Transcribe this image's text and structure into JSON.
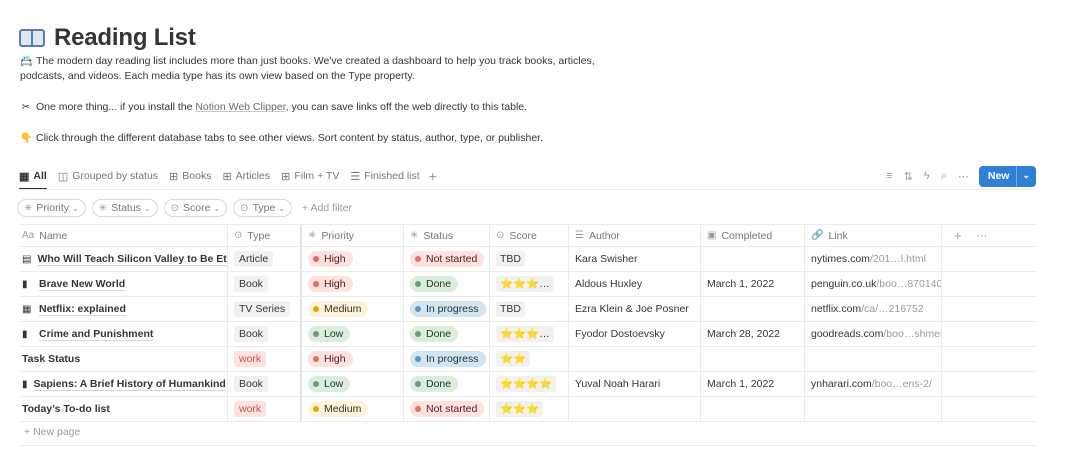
{
  "page": {
    "title": "Reading List",
    "icon": "open-book-icon",
    "desc1_icon": "📇",
    "desc1": "The modern day reading list includes more than just books. We've created a dashboard to help you track books, articles,",
    "desc1b": "podcasts, and videos. Each media type has its own view based on the Type property.",
    "desc2_icon": "✂",
    "desc2_pre": "One more thing... if you install the ",
    "desc2_link": "Notion Web Clipper",
    "desc2_post": ", you can save links off the web directly to this table.",
    "desc3_icon": "👇",
    "desc3": "Click through the different database tabs to see other views. Sort content by status, author, type, or publisher."
  },
  "tabs": [
    {
      "label": "All",
      "icon": "table-icon"
    },
    {
      "label": "Grouped by status",
      "icon": "board-icon"
    },
    {
      "label": "Books",
      "icon": "gallery-icon"
    },
    {
      "label": "Articles",
      "icon": "gallery-icon"
    },
    {
      "label": "Film + TV",
      "icon": "gallery-icon"
    },
    {
      "label": "Finished list",
      "icon": "list-icon"
    }
  ],
  "toolbar": {
    "new_label": "New",
    "accent": "#2f80d3"
  },
  "filters": [
    {
      "label": "Priority"
    },
    {
      "label": "Status"
    },
    {
      "label": "Score"
    },
    {
      "label": "Type"
    }
  ],
  "add_filter_label": "+ Add filter",
  "columns": [
    "Name",
    "Type",
    "Priority",
    "Status",
    "Score",
    "Author",
    "Completed",
    "Link"
  ],
  "rows": [
    {
      "name": "Who Will Teach Silicon Valley to Be Ethi",
      "type": "Article",
      "priority": "High",
      "status": "Not started",
      "score": "TBD",
      "author": "Kara Swisher",
      "completed": "",
      "link_host": "nytimes.com",
      "link_path": "/201…l.html",
      "has_icon": true
    },
    {
      "name": "Brave New World",
      "type": "Book",
      "priority": "High",
      "status": "Done",
      "score": "⭐⭐⭐…",
      "author": "Aldous Huxley",
      "completed": "March 1, 2022",
      "link_host": "penguin.co.uk",
      "link_path": "/boo…870140",
      "has_icon": true
    },
    {
      "name": "Netflix: explained",
      "type": "TV Series",
      "priority": "Medium",
      "status": "In progress",
      "score": "TBD",
      "author": "Ezra Klein & Joe Posner",
      "completed": "",
      "link_host": "netflix.com",
      "link_path": "/ca/…216752",
      "has_icon": true
    },
    {
      "name": "Crime and Punishment",
      "type": "Book",
      "priority": "Low",
      "status": "Done",
      "score": "⭐⭐⭐…",
      "author": "Fyodor Dostoevsky",
      "completed": "March 28, 2022",
      "link_host": "goodreads.com",
      "link_path": "/boo…shment",
      "has_icon": true
    },
    {
      "name": "Task Status",
      "type": "work",
      "priority": "High",
      "status": "In progress",
      "score": "⭐⭐",
      "author": "",
      "completed": "",
      "link_host": "",
      "link_path": "",
      "has_icon": false
    },
    {
      "name": "Sapiens: A Brief History of Humankind",
      "type": "Book",
      "priority": "Low",
      "status": "Done",
      "score": "⭐⭐⭐⭐",
      "author": "Yuval Noah Harari",
      "completed": "March 1, 2022",
      "link_host": "ynharari.com",
      "link_path": "/boo…ens-2/",
      "has_icon": true
    },
    {
      "name": "Today’s To-do list",
      "type": "work",
      "priority": "Medium",
      "status": "Not started",
      "score": "⭐⭐⭐",
      "author": "",
      "completed": "",
      "link_host": "",
      "link_path": "",
      "has_icon": false
    }
  ],
  "new_page_label": "New page"
}
